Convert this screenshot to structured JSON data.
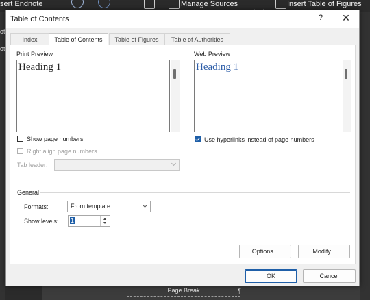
{
  "background": {
    "ribbon": {
      "insert_endnote": "sert Endnote",
      "manage_sources": "Manage Sources",
      "insert_table_of_figures": "Insert Table of Figures",
      "side_fragment_1": "ote",
      "side_fragment_2": "ot"
    },
    "page_break_label": "Page Break",
    "page_break_mark": "¶"
  },
  "dialog": {
    "title": "Table of Contents",
    "help_glyph": "?",
    "close_glyph": "✕",
    "tabs": [
      {
        "label": "Index",
        "active": false
      },
      {
        "label": "Table of Contents",
        "active": true
      },
      {
        "label": "Table of Figures",
        "active": false
      },
      {
        "label": "Table of Authorities",
        "active": false
      }
    ],
    "print_preview": {
      "label": "Print Preview",
      "sample_text": "Heading 1"
    },
    "web_preview": {
      "label": "Web Preview",
      "sample_text": "Heading 1"
    },
    "options": {
      "show_page_numbers": {
        "label": "Show page numbers",
        "checked": false
      },
      "right_align_page_numbers": {
        "label": "Right align page numbers",
        "checked": false,
        "disabled": true
      },
      "tab_leader": {
        "label": "Tab leader:",
        "value": "......",
        "disabled": true
      },
      "use_hyperlinks": {
        "label": "Use hyperlinks instead of page numbers",
        "checked": true
      }
    },
    "general": {
      "label": "General",
      "formats": {
        "label": "Formats:",
        "value": "From template"
      },
      "show_levels": {
        "label": "Show levels:",
        "value": "1"
      }
    },
    "buttons": {
      "options": "Options...",
      "modify": "Modify...",
      "ok": "OK",
      "cancel": "Cancel"
    }
  },
  "colors": {
    "accent": "#1f5fa8",
    "link": "#2e5ea8",
    "dialog_bg": "#f0f0f0",
    "app_bg": "#2b2b2b"
  }
}
